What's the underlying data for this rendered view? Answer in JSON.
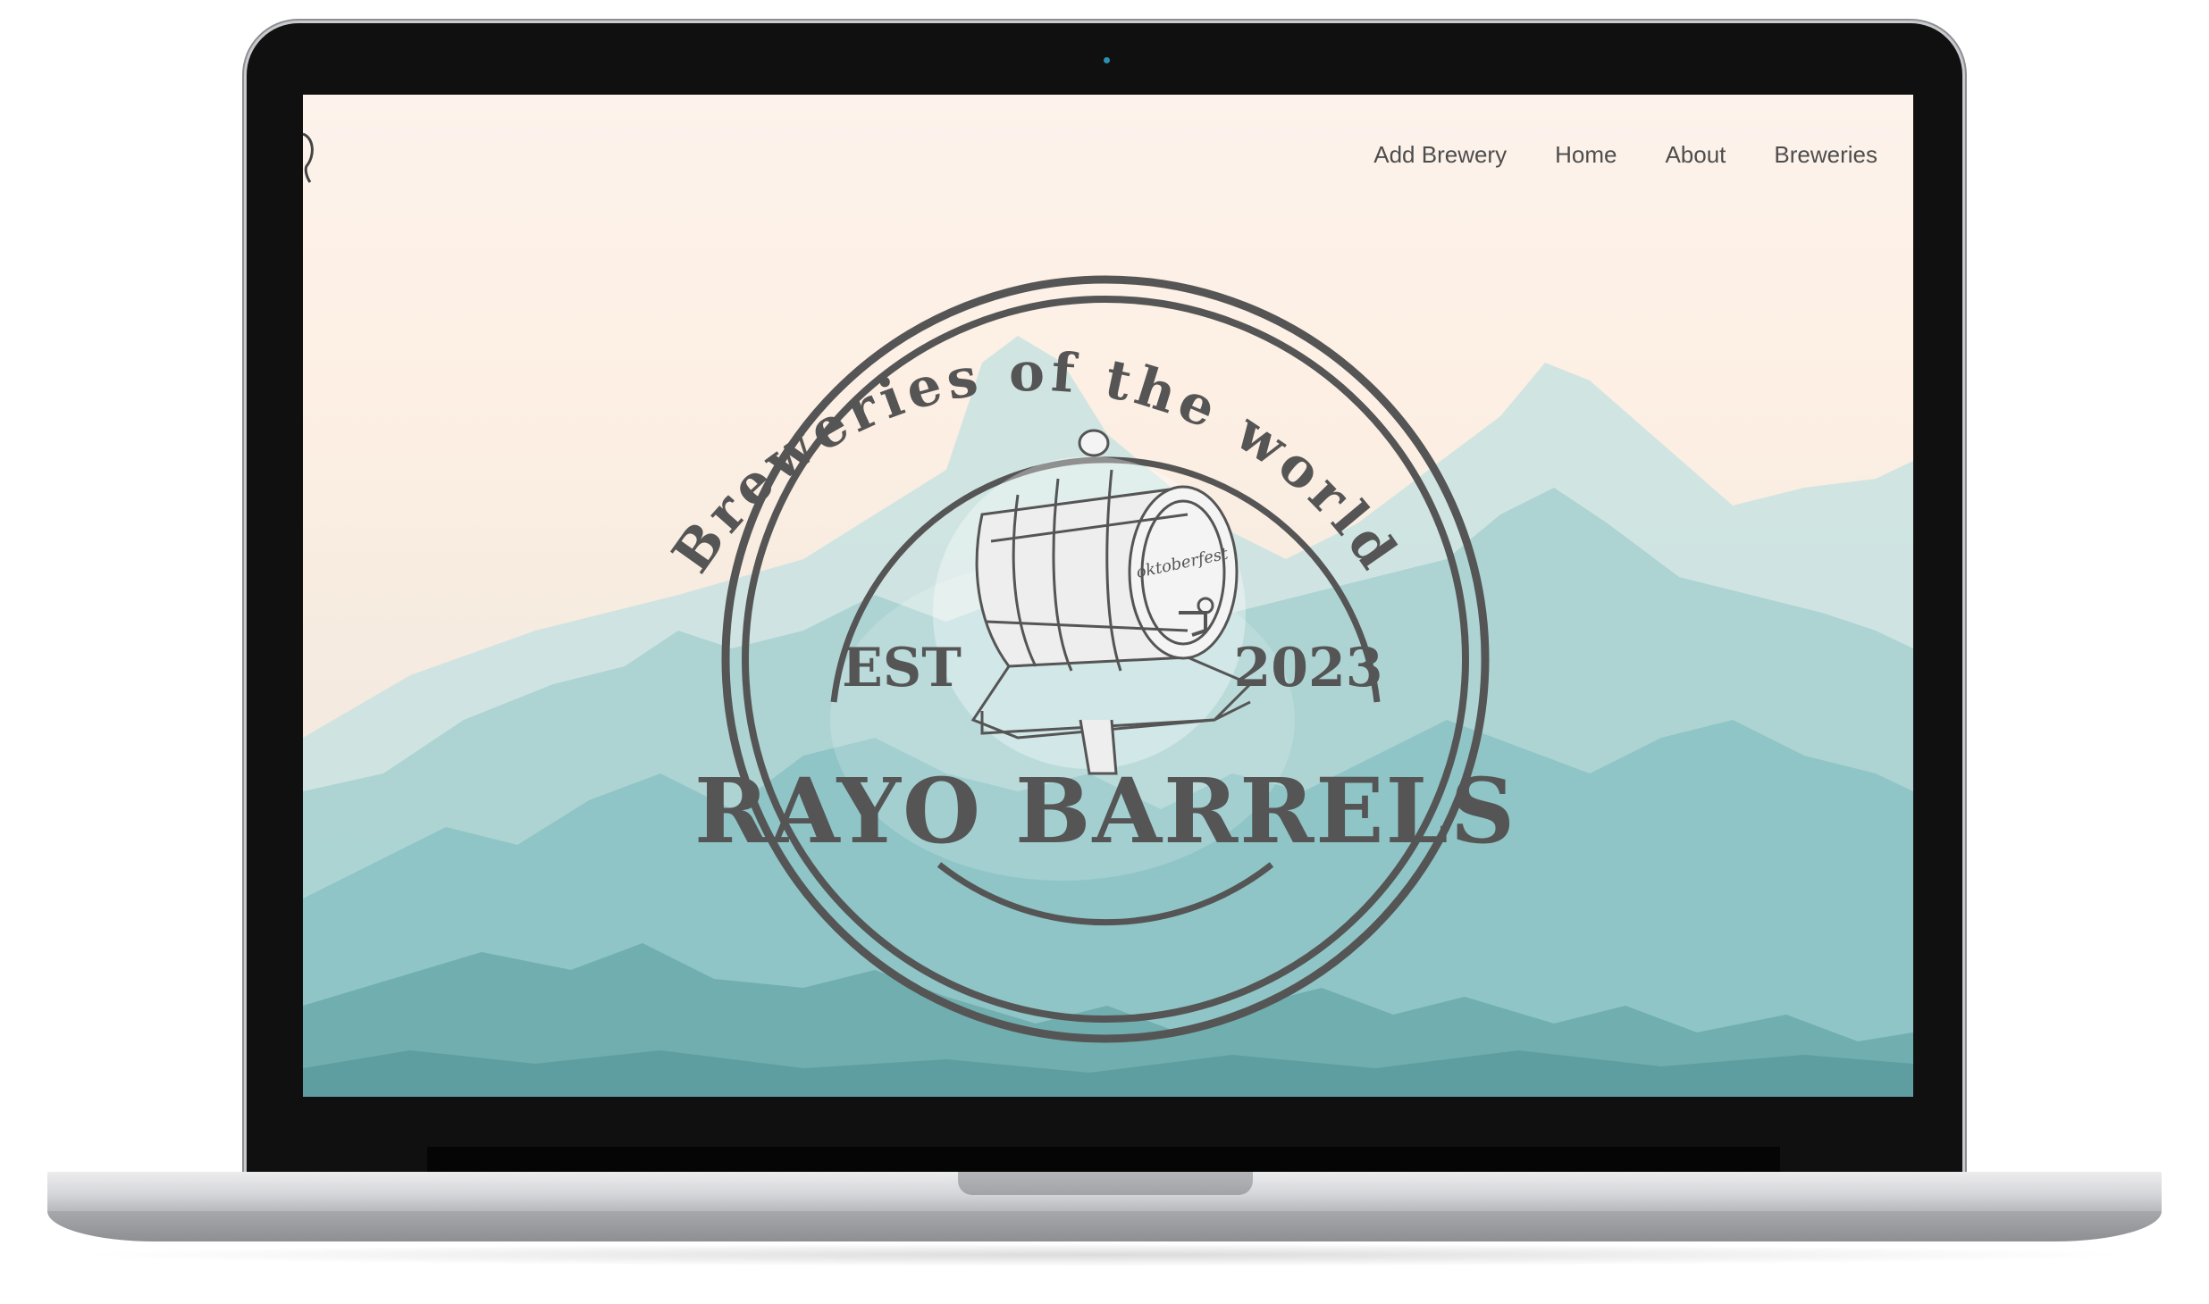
{
  "nav": {
    "items": [
      {
        "label": "Add Brewery"
      },
      {
        "label": "Home"
      },
      {
        "label": "About"
      },
      {
        "label": "Breweries"
      }
    ]
  },
  "hero": {
    "arc_text": "Breweries of the world",
    "est_label": "EST",
    "year": "2023",
    "brand": "RAYO BARRELS",
    "barrel_label": "oktoberfest"
  },
  "colors": {
    "sky": "#fdf3ec",
    "mountain_light": "#b9dcdc",
    "mountain_mid": "#8cc3c4",
    "mountain_dark": "#5f9ea0",
    "emblem": "#555555",
    "nav_text": "#4d4d4d"
  }
}
